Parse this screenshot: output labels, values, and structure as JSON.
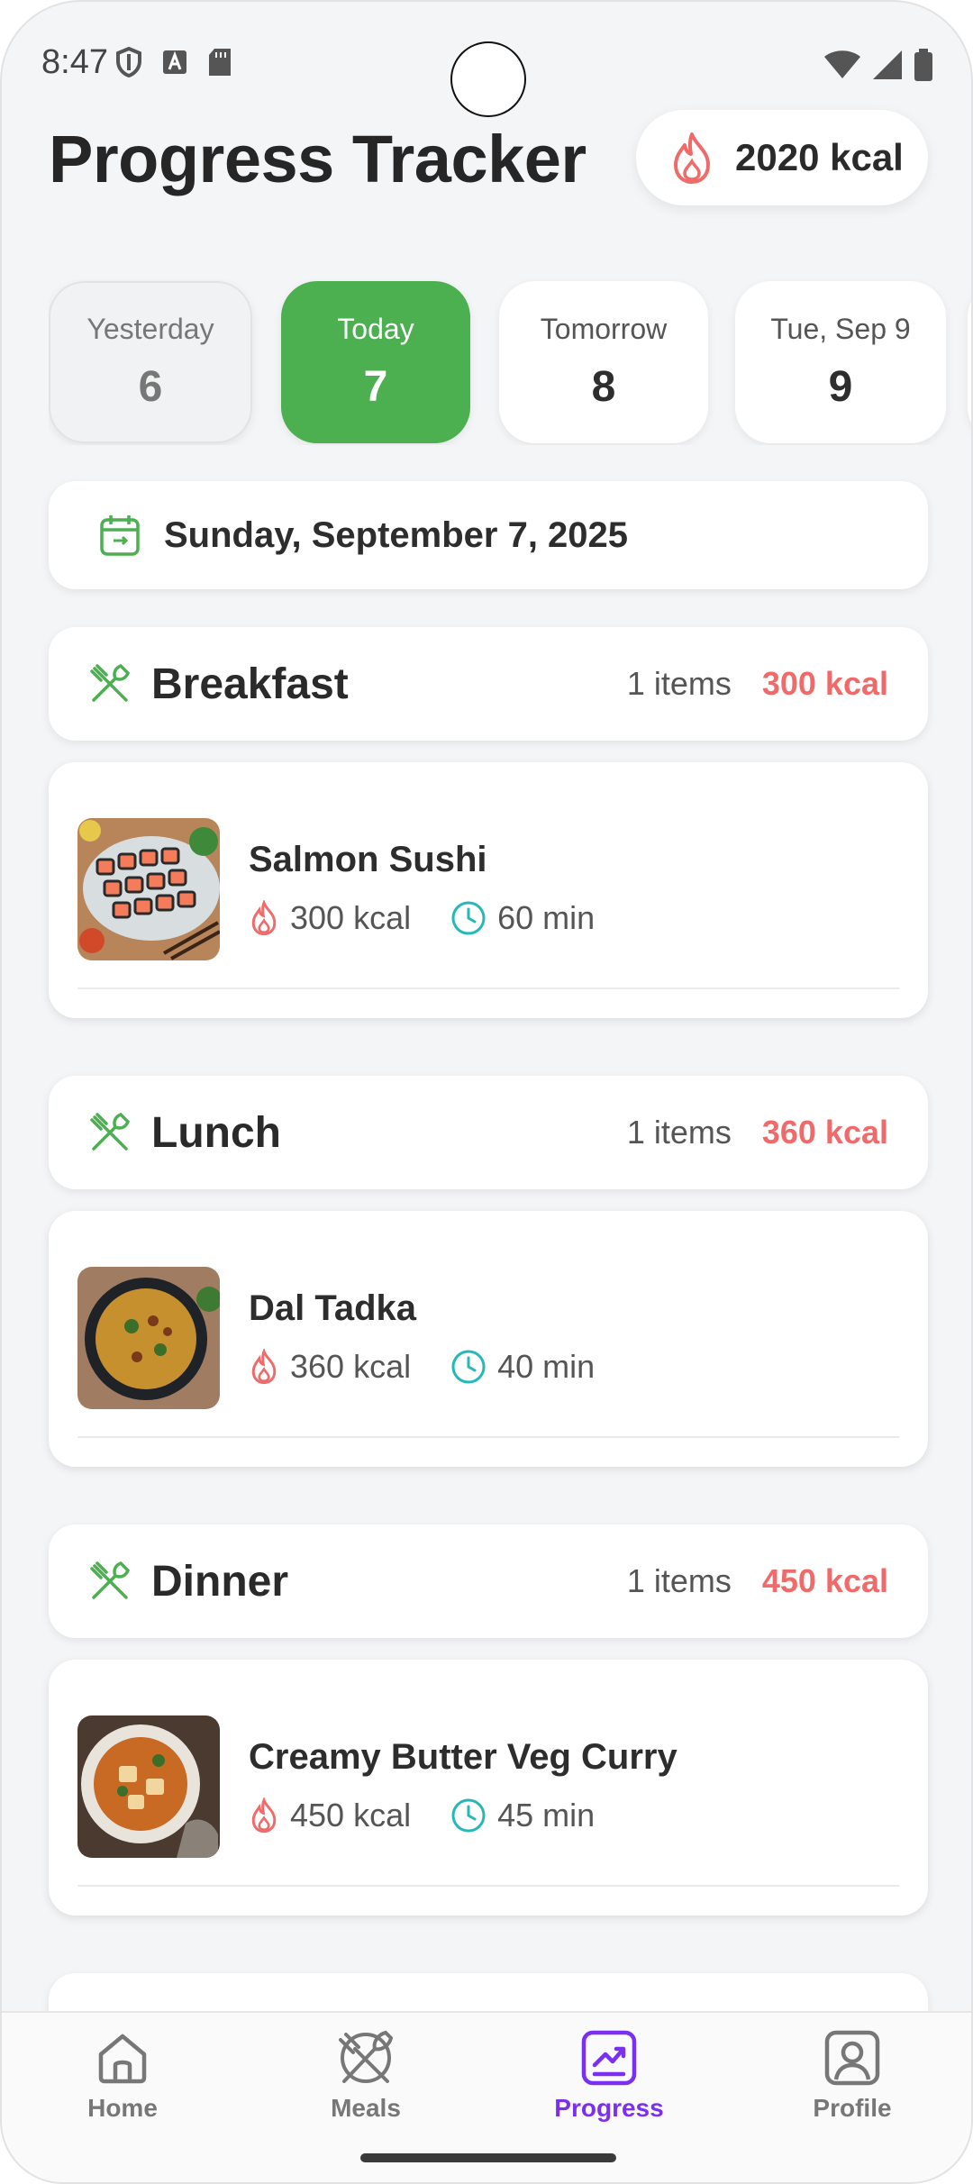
{
  "status_bar": {
    "time": "8:47"
  },
  "header": {
    "title": "Progress Tracker",
    "total_kcal": "2020 kcal"
  },
  "dates": [
    {
      "label": "Yesterday",
      "num": "6"
    },
    {
      "label": "Today",
      "num": "7"
    },
    {
      "label": "Tomorrow",
      "num": "8"
    },
    {
      "label": "Tue, Sep 9",
      "num": "9"
    }
  ],
  "selected_date": "Sunday, September 7, 2025",
  "meals": [
    {
      "title": "Breakfast",
      "count": "1 items",
      "kcal": "300 kcal",
      "item": {
        "name": "Salmon Sushi",
        "kcal": "300 kcal",
        "time": "60 min"
      }
    },
    {
      "title": "Lunch",
      "count": "1 items",
      "kcal": "360 kcal",
      "item": {
        "name": "Dal Tadka",
        "kcal": "360 kcal",
        "time": "40 min"
      }
    },
    {
      "title": "Dinner",
      "count": "1 items",
      "kcal": "450 kcal",
      "item": {
        "name": "Creamy Butter Veg Curry",
        "kcal": "450 kcal",
        "time": "45 min"
      }
    }
  ],
  "nav": [
    {
      "label": "Home",
      "icon": "home-icon"
    },
    {
      "label": "Meals",
      "icon": "meals-icon"
    },
    {
      "label": "Progress",
      "icon": "progress-icon",
      "active": true
    },
    {
      "label": "Profile",
      "icon": "profile-icon"
    }
  ],
  "colors": {
    "accent_green": "#4caf50",
    "kcal_red": "#f06a6a",
    "nav_active": "#7b2ff0",
    "time_teal": "#26b8b8"
  }
}
